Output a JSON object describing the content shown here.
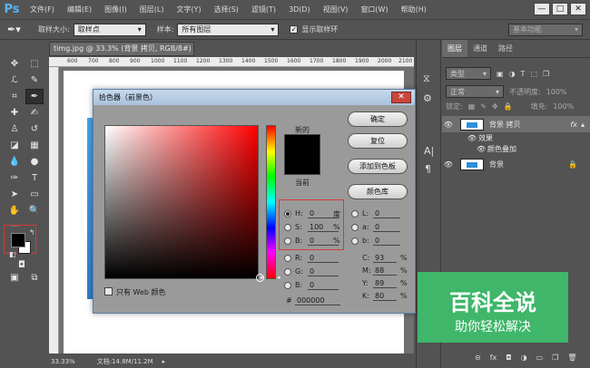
{
  "app": {
    "logo": "Ps"
  },
  "menu": [
    "文件(F)",
    "编辑(E)",
    "图像(I)",
    "图层(L)",
    "文字(Y)",
    "选择(S)",
    "滤镜(T)",
    "3D(D)",
    "视图(V)",
    "窗口(W)",
    "帮助(H)"
  ],
  "window_buttons": [
    "—",
    "□",
    "✕"
  ],
  "options": {
    "sample_size_label": "取样大小:",
    "sample_size_value": "取样点",
    "sample_label": "样本:",
    "sample_value": "所有图层",
    "show_ring_checked": "✓",
    "show_ring_label": "显示取样环",
    "workspace_value": "基本功能"
  },
  "document": {
    "tab_title": "timg.jpg @ 33.3% (背景 拷贝, RGB/8#) *",
    "tab_close": "×",
    "ruler_ticks": [
      "600",
      "700",
      "800",
      "900",
      "1000",
      "1100",
      "1200",
      "1300",
      "1400",
      "1500",
      "1600",
      "1700",
      "1800",
      "1900",
      "2000",
      "2100"
    ],
    "zoom": "33.33%",
    "doc_info": "文档:14.8M/11.2M"
  },
  "layers_panel": {
    "tabs": [
      "图层",
      "通道",
      "路径"
    ],
    "filter_kind": "类型",
    "blend_mode": "正常",
    "opacity_label": "不透明度:",
    "opacity_value": "100%",
    "lock_label": "锁定:",
    "fill_label": "填充:",
    "fill_value": "100%",
    "layers": [
      {
        "name": "背景 拷贝",
        "fx": "fx"
      },
      {
        "name": "效果"
      },
      {
        "name": "颜色叠加"
      },
      {
        "name": "背景"
      }
    ]
  },
  "color_picker": {
    "title": "拾色器（前景色）",
    "close": "✕",
    "new_label": "新的",
    "current_label": "当前",
    "buttons": {
      "ok": "确定",
      "reset": "复位",
      "add_swatch": "添加到色板",
      "color_library": "颜色库"
    },
    "web_only_label": "只有 Web 颜色",
    "hsb": [
      {
        "label": "H:",
        "value": "0",
        "unit": "度"
      },
      {
        "label": "S:",
        "value": "100",
        "unit": "%"
      },
      {
        "label": "B:",
        "value": "0",
        "unit": "%"
      }
    ],
    "rgb": [
      {
        "label": "R:",
        "value": "0"
      },
      {
        "label": "G:",
        "value": "0"
      },
      {
        "label": "B:",
        "value": "0"
      }
    ],
    "lab": [
      {
        "label": "L:",
        "value": "0"
      },
      {
        "label": "a:",
        "value": "0"
      },
      {
        "label": "b:",
        "value": "0"
      }
    ],
    "cmyk": [
      {
        "label": "C:",
        "value": "93",
        "unit": "%"
      },
      {
        "label": "M:",
        "value": "88",
        "unit": "%"
      },
      {
        "label": "Y:",
        "value": "89",
        "unit": "%"
      },
      {
        "label": "K:",
        "value": "80",
        "unit": "%"
      }
    ],
    "hex_label": "#",
    "hex_value": "000000",
    "new_color": "#000000",
    "current_color": "#000000"
  },
  "watermark": {
    "title": "百科全说",
    "subtitle": "助你轻松解决"
  }
}
